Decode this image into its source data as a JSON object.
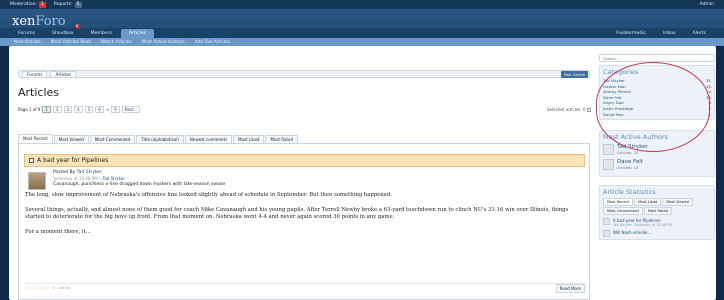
{
  "modbar": {
    "moderation_label": "Moderation:",
    "moderation_count": "1",
    "reports_label": "Reports:",
    "reports_count": "5",
    "admin_label": "Admin"
  },
  "header": {
    "logo_main": "xen",
    "logo_accent": "Foro"
  },
  "nav": {
    "tabs": [
      "Forums",
      "Shoutbox",
      "Members",
      "Articles"
    ],
    "notification": "6",
    "right": [
      "Huskermedic",
      "Inbox",
      "Alerts"
    ]
  },
  "subnav": [
    "New Articles",
    "Mark Articles Read",
    "Watch Articles",
    "Most Active Authors",
    "Add Two Articles"
  ],
  "breadcrumb": [
    "Forums",
    "Articles"
  ],
  "post_button": "Post Article",
  "page_title": "Articles",
  "pager": {
    "label": "Page 1 of 9",
    "pages": [
      "1",
      "2",
      "3",
      "4",
      "5",
      "6"
    ],
    "ellipsis": "→",
    "last": "9",
    "next": "Next ›"
  },
  "selected": "Selected articles: 0",
  "tabs": [
    "Most Recent",
    "Most Viewed",
    "Most Commented",
    "Title (alphabetical)",
    "Newest comments",
    "Most Liked",
    "Most Rated"
  ],
  "article": {
    "title": "A bad year for Pipelines",
    "posted_by": "Posted By",
    "author": "Tad Stryker",
    "date": "Yesterday at 10:48 PM",
    "tag_sep": "•",
    "tag": "Tad Stryker",
    "lead": "Cavanaugh, punchless o-line dragged down Huskers with late-season swoon",
    "p1": "The long, slow improvement of Nebraska's offensive line looked slightly ahead of schedule in September. But then something happened.",
    "p2": "Several things, actually, and almost none of them good for coach Mike Cavanaugh and his young pupils. After Terrell Newby broke a 63-yard touchdown run to clinch NU's 31-16 win over Illinois, things started to deteriorate for the big boys up front. From that moment on, Nebraska went 4-4 and never again scored 30 points in any game.",
    "p3": "For a moment there, it...",
    "stars": "☆☆☆☆☆",
    "votes": "0 votes",
    "read_more": "Read More"
  },
  "sidebar": {
    "search_placeholder": "Search...",
    "categories_title": "Categories",
    "categories": [
      {
        "name": "Tad Stryker",
        "count": "31"
      },
      {
        "name": "Husker Dan",
        "count": "15"
      },
      {
        "name": "Jeremy Pernell",
        "count": "14"
      },
      {
        "name": "Dave Felt",
        "count": "18"
      },
      {
        "name": "Angry Dad",
        "count": "0"
      },
      {
        "name": "Justin Prestidge",
        "count": "2"
      },
      {
        "name": "David Max",
        "count": "1"
      }
    ],
    "authors_title": "Most Active Authors",
    "authors": [
      {
        "name": "Tad Stryker",
        "sub": "Articles: 31"
      },
      {
        "name": "Dave Felt",
        "sub": "Articles: 18"
      }
    ],
    "stats_title": "Article Statistics",
    "stat_tabs": [
      "Most Recent",
      "Most Liked",
      "Most Viewed",
      "Most Commented",
      "Most Rated"
    ],
    "stats": [
      {
        "title": "A bad year for Pipelines",
        "sub": "Tad Stryker, Yesterday at 10:48 PM"
      },
      {
        "title": "Will Nash-ville Be...",
        "sub": ""
      }
    ]
  }
}
